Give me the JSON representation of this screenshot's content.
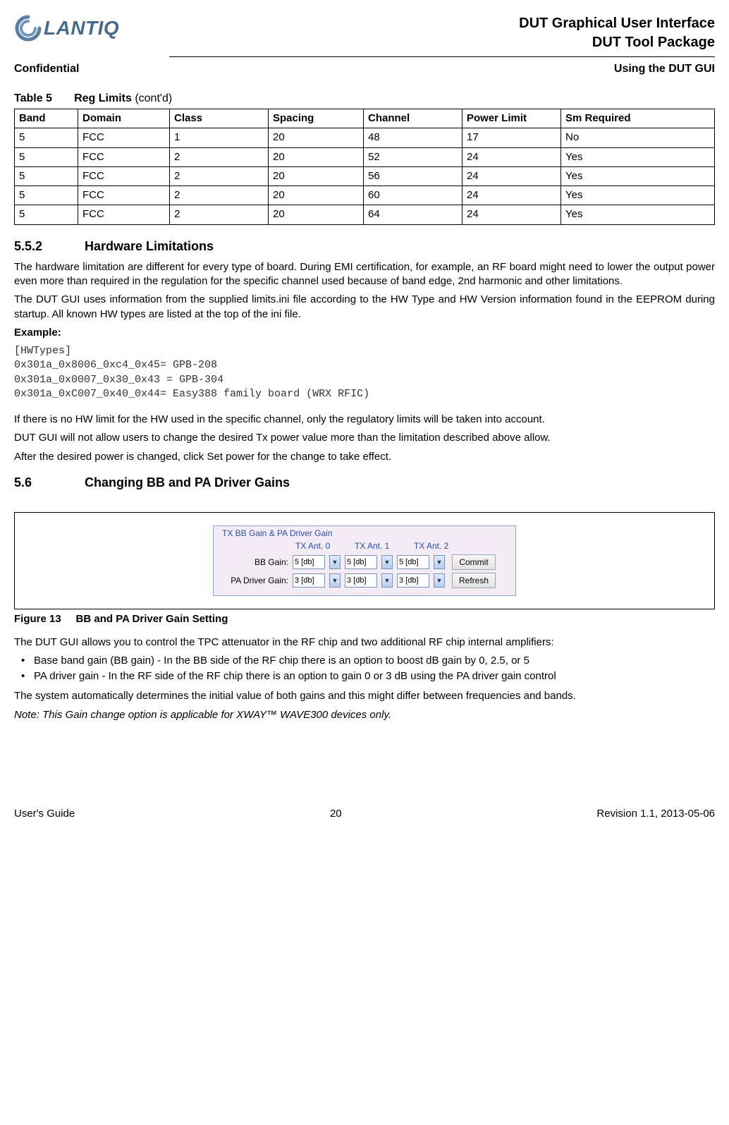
{
  "header": {
    "logo_text": "LANTIQ",
    "title1": "DUT Graphical User Interface",
    "title2": "DUT Tool Package",
    "left_tag": "Confidential",
    "right_tag": "Using the DUT GUI"
  },
  "table5": {
    "caption_label": "Table 5",
    "caption_title": "Reg Limits",
    "caption_suffix": " (cont'd)",
    "headers": [
      "Band",
      "Domain",
      "Class",
      "Spacing",
      "Channel",
      "Power Limit",
      "Sm Required"
    ],
    "rows": [
      [
        "5",
        "FCC",
        "1",
        "20",
        "48",
        "17",
        "No"
      ],
      [
        "5",
        "FCC",
        "2",
        "20",
        "52",
        "24",
        "Yes"
      ],
      [
        "5",
        "FCC",
        "2",
        "20",
        "56",
        "24",
        "Yes"
      ],
      [
        "5",
        "FCC",
        "2",
        "20",
        "60",
        "24",
        "Yes"
      ],
      [
        "5",
        "FCC",
        "2",
        "20",
        "64",
        "24",
        "Yes"
      ]
    ]
  },
  "s552": {
    "num": "5.5.2",
    "title": "Hardware Limitations",
    "p1": "The hardware limitation are different for every type of board. During EMI certification, for example, an RF board might need to lower the output power even more than required in the regulation for the specific channel used because of band edge, 2nd harmonic and other limitations.",
    "p2": "The DUT GUI uses information from the supplied limits.ini file according to the HW Type and HW Version information found in the EEPROM during startup. All known HW types are listed at the top of the ini file.",
    "example_label": "Example:",
    "code": "[HWTypes]\n0x301a_0x8006_0xc4_0x45= GPB-208\n0x301a_0x0007_0x30_0x43 = GPB-304\n0x301a_0xC007_0x40_0x44= Easy388 family board (WRX RFIC)",
    "p3": "If there is no HW limit for the HW used in the specific channel, only the regulatory limits will be taken into account.",
    "p4": "DUT GUI will not allow users to change the desired Tx power value more than the limitation described above allow.",
    "p5": "After the desired power is changed, click Set power for the change to take effect."
  },
  "s56": {
    "num": "5.6",
    "title": "Changing BB and PA Driver Gains"
  },
  "fig13": {
    "panel_title": "TX BB Gain & PA Driver Gain",
    "ant_labels": [
      "TX Ant. 0",
      "TX Ant. 1",
      "TX Ant. 2"
    ],
    "row_labels": [
      "",
      "BB Gain:",
      "PA Driver Gain:"
    ],
    "bb_values": [
      "5 [db]",
      "5 [db]",
      "5 [db]"
    ],
    "pa_values": [
      "3 [db]",
      "3 [db]",
      "3 [db]"
    ],
    "buttons": {
      "commit": "Commit",
      "refresh": "Refresh"
    },
    "cap_label": "Figure 13",
    "cap_title": "BB and PA Driver Gain Setting"
  },
  "after_fig": {
    "p1": "The DUT GUI allows you to control the TPC attenuator in the RF chip and two additional RF chip internal amplifiers:",
    "bullets": [
      "Base band gain (BB gain) - In the BB side of the RF chip there is an option to boost dB gain by 0, 2.5, or 5",
      "PA driver gain - In the RF side of the RF chip there is an option to gain 0 or 3 dB using the PA driver gain control"
    ],
    "p2": "The system automatically determines the initial value of both gains and this might differ between frequencies and bands.",
    "note": "Note: This Gain change option is applicable for XWAY™ WAVE300 devices only."
  },
  "footer": {
    "left": "User's Guide",
    "center": "20",
    "right": "Revision 1.1, 2013-05-06"
  }
}
